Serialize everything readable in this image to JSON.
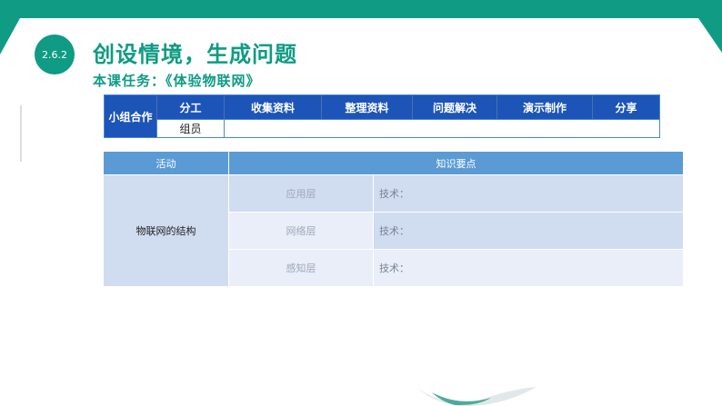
{
  "section_number": "2.6.2",
  "title": "创设情境，生成问题",
  "subtitle": "本课任务：《体验物联网》",
  "group_table": {
    "label": "小组合作",
    "headers": [
      "分工",
      "收集资料",
      "整理资料",
      "问题解决",
      "演示制作",
      "分享"
    ],
    "member_label": "组员",
    "member_value": ""
  },
  "activity_table": {
    "headers": [
      "活动",
      "知识要点"
    ],
    "activity": "物联网的结构",
    "rows": [
      {
        "layer": "应用层",
        "tech": "技术："
      },
      {
        "layer": "网络层",
        "tech": "技术："
      },
      {
        "layer": "感知层",
        "tech": "技术："
      }
    ]
  },
  "colors": {
    "brand_green": "#0f9b84",
    "group_header_blue": "#1d54b8",
    "activity_header_blue": "#5b9bd5",
    "row_light_blue": "#d0dcf0",
    "row_lighter_blue": "#e9eef8"
  }
}
